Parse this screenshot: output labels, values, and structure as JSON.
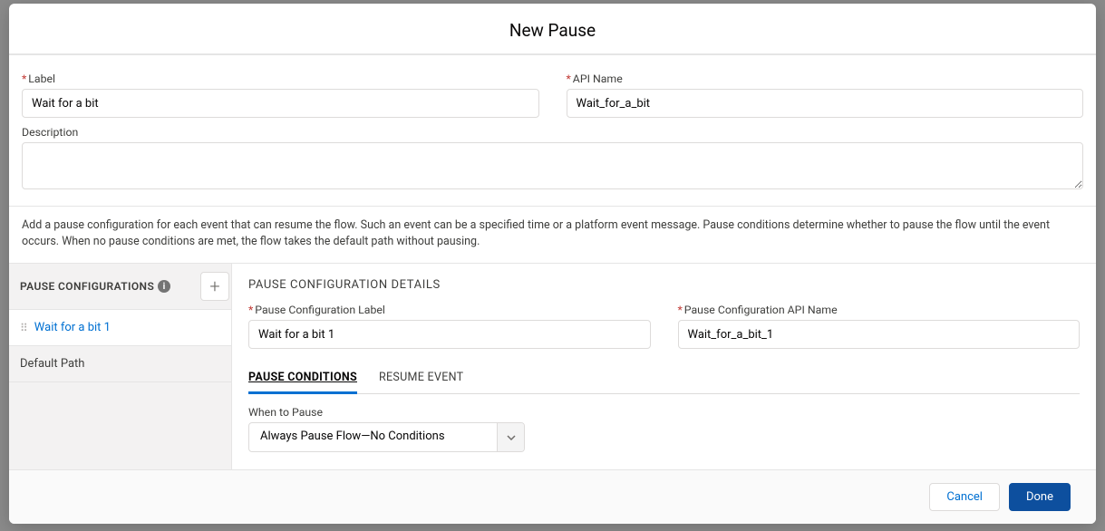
{
  "modal": {
    "title": "New Pause"
  },
  "fields": {
    "label_caption": "Label",
    "label_value": "Wait for a bit",
    "api_caption": "API Name",
    "api_value": "Wait_for_a_bit",
    "description_caption": "Description",
    "description_value": ""
  },
  "help_text": "Add a pause configuration for each event that can resume the flow. Such an event can be a specified time or a platform event message. Pause conditions determine whether to pause the flow until the event occurs. When no pause conditions are met, the flow takes the default path without pausing.",
  "sidebar": {
    "title": "PAUSE CONFIGURATIONS",
    "items": [
      {
        "label": "Wait for a bit 1",
        "active": true,
        "draggable": true
      },
      {
        "label": "Default Path",
        "active": false,
        "draggable": false
      }
    ]
  },
  "details": {
    "title": "PAUSE CONFIGURATION DETAILS",
    "config_label_caption": "Pause Configuration Label",
    "config_label_value": "Wait for a bit 1",
    "config_api_caption": "Pause Configuration API Name",
    "config_api_value": "Wait_for_a_bit_1"
  },
  "tabs": {
    "conditions": "PAUSE CONDITIONS",
    "resume": "RESUME EVENT"
  },
  "when_to_pause": {
    "label": "When to Pause",
    "selected": "Always Pause Flow—No Conditions"
  },
  "footer": {
    "cancel": "Cancel",
    "done": "Done"
  }
}
